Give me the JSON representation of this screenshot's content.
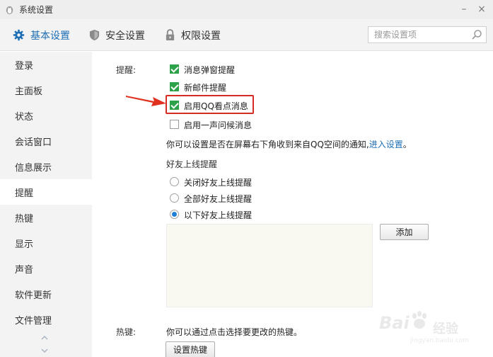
{
  "window": {
    "title": "系统设置",
    "minimize_glyph": "–",
    "close_glyph": "×"
  },
  "toolbar": {
    "tabs": [
      {
        "label": "基本设置",
        "icon": "gear-icon",
        "active": true
      },
      {
        "label": "安全设置",
        "icon": "shield-icon",
        "active": false
      },
      {
        "label": "权限设置",
        "icon": "lock-icon",
        "active": false
      }
    ],
    "search_placeholder": "搜索设置项"
  },
  "sidebar": {
    "items": [
      {
        "label": "登录"
      },
      {
        "label": "主面板"
      },
      {
        "label": "状态"
      },
      {
        "label": "会话窗口"
      },
      {
        "label": "信息展示"
      },
      {
        "label": "提醒",
        "active": true
      },
      {
        "label": "热键"
      },
      {
        "label": "显示"
      },
      {
        "label": "声音"
      },
      {
        "label": "软件更新"
      },
      {
        "label": "文件管理"
      }
    ]
  },
  "reminder": {
    "section_label": "提醒:",
    "options": [
      {
        "label": "消息弹窗提醒",
        "checked": true
      },
      {
        "label": "新邮件提醒",
        "checked": true
      },
      {
        "label": "启用QQ看点消息",
        "checked": true,
        "highlighted": true
      },
      {
        "label": "启用一声问候消息",
        "checked": false
      }
    ],
    "info_text": "你可以设置是否在屏幕右下角收到来自QQ空间的通知,",
    "info_link": "进入设置",
    "info_end": "。",
    "friend_online_label": "好友上线提醒",
    "friend_options": [
      {
        "label": "关闭好友上线提醒",
        "selected": false
      },
      {
        "label": "全部好友上线提醒",
        "selected": false
      },
      {
        "label": "以下好友上线提醒",
        "selected": true
      }
    ],
    "add_button": "添加"
  },
  "hotkey": {
    "section_label": "热键:",
    "description": "你可以通过点击选择要更改的热键。",
    "button": "设置热键"
  },
  "watermark": {
    "brand": "Bai",
    "suffix": "经验",
    "url": "jingyan.baidu.com"
  },
  "colors": {
    "accent": "#1f6fb5",
    "check_green": "#2ea24a",
    "highlight_red": "#d62b22"
  }
}
